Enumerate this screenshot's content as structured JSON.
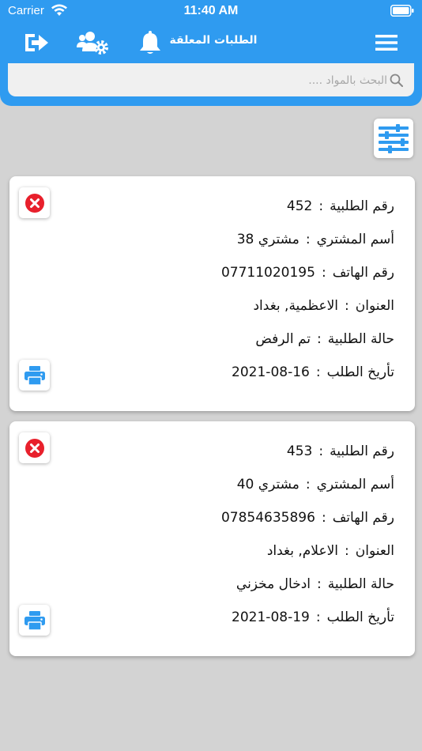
{
  "status_bar": {
    "carrier": "Carrier",
    "time": "11:40 AM"
  },
  "header": {
    "title": "الطلبات المعلقة"
  },
  "icons": {
    "logout": "logout-icon",
    "users_settings": "users-settings-icon",
    "notifications": "bell-icon",
    "menu": "hamburger-menu-icon"
  },
  "search": {
    "placeholder": "البحث بالمواد ...."
  },
  "colors": {
    "primary": "#2f9bf0",
    "background": "#d3d3d3",
    "cancel": "#e8202c",
    "print": "#2f9bf0"
  },
  "labels": {
    "order_number": "رقم الطلبية",
    "buyer_name": "أسم المشتري",
    "phone": "رقم الهاتف",
    "address": "العنوان",
    "order_status": "حالة الطلبية",
    "order_date": "تأريخ الطلب",
    "separator": ":"
  },
  "orders": [
    {
      "order_number": "452",
      "buyer_name": "مشتري 38",
      "phone": "07711020195",
      "address": "الاعظمية, بغداد",
      "order_status": "تم الرفض",
      "order_date": "16-08-2021"
    },
    {
      "order_number": "453",
      "buyer_name": "مشتري 40",
      "phone": "07854635896",
      "address": "الاعلام, بغداد",
      "order_status": "ادخال مخزني",
      "order_date": "19-08-2021"
    }
  ]
}
